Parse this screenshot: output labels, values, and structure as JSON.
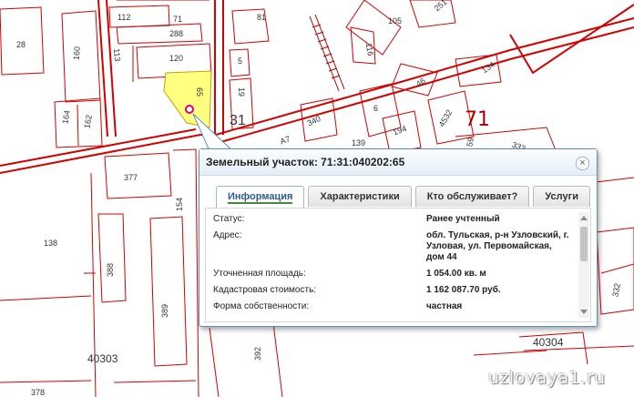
{
  "map": {
    "plot_labels": [
      "28",
      "160",
      "112",
      "71",
      "288",
      "113",
      "120",
      "81",
      "105",
      "251",
      "116",
      "5",
      "19",
      "65",
      "31",
      "134",
      "46",
      "6",
      "194",
      "4532",
      "340",
      "164",
      "162",
      "377",
      "138",
      "154",
      "388",
      "389",
      "392",
      "332",
      "378",
      "A7",
      "139",
      "59",
      "333"
    ],
    "block_label": "71",
    "quarter_labels": [
      "40303",
      "40304"
    ],
    "colors": {
      "boundary": "#d40000",
      "highlight": "#ffff80",
      "marker": "#e0007a"
    }
  },
  "popup": {
    "title": "Земельный участок: 71:31:040202:65",
    "close_icon": "close-icon",
    "tabs": [
      "Информация",
      "Характеристики",
      "Кто обслуживает?",
      "Услуги"
    ],
    "active_tab": "Информация",
    "rows": [
      {
        "label": "Статус:",
        "value": "Ранее учтенный"
      },
      {
        "label": "Адрес:",
        "value": "обл. Тульская, р-н Узловский, г. Узловая, ул. Первомайская, дом 44"
      },
      {
        "label": "Уточненная площадь:",
        "value": "1 054.00 кв. м"
      },
      {
        "label": "Кадастровая стоимость:",
        "value": "1 162 087.70 руб."
      },
      {
        "label": "Форма собственности:",
        "value": "частная"
      }
    ]
  },
  "watermark": "uzlovaya1.ru"
}
